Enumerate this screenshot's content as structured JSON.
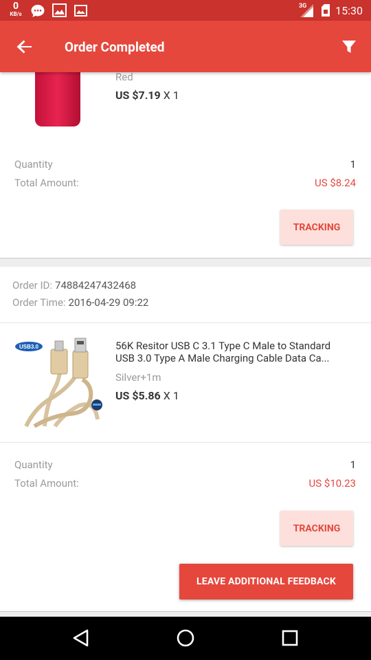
{
  "status_bar": {
    "net_speed": "0",
    "net_unit": "KB/s",
    "network": "3G",
    "time": "15:30"
  },
  "app_bar": {
    "title": "Order Completed"
  },
  "order_1": {
    "variant": "Red",
    "price": "US $7.19",
    "qty": "X 1",
    "quantity_label": "Quantity",
    "quantity_value": "1",
    "total_label": "Total Amount:",
    "total_value": "US $8.24",
    "tracking_label": "TRACKING"
  },
  "order_2": {
    "order_id_label": "Order ID:",
    "order_id": "74884247432468",
    "order_time_label": "Order Time:",
    "order_time": "2016-04-29 09:22",
    "product_title_line1": "56K Resitor USB C 3.1 Type C Male to Standard",
    "product_title_line2": "USB 3.0 Type A Male Charging Cable Data Ca...",
    "badge": "USB3.0",
    "variant": "Silver+1m",
    "price": "US $5.86",
    "qty": "X 1",
    "quantity_label": "Quantity",
    "quantity_value": "1",
    "total_label": "Total Amount:",
    "total_value": "US $10.23",
    "tracking_label": "TRACKING",
    "feedback_label": "LEAVE ADDITIONAL FEEDBACK"
  },
  "colors": {
    "status_bar": "#c9322d",
    "app_bar": "#e5473d",
    "accent": "#e5473d",
    "tracking_bg": "#fde0db"
  },
  "icons": [
    "arrow-back-icon",
    "filter-icon",
    "message-icon",
    "image-icon",
    "picture-icon",
    "signal-icon",
    "sim-icon",
    "battery-icon",
    "back-triangle-icon",
    "home-circle-icon",
    "recents-square-icon"
  ]
}
